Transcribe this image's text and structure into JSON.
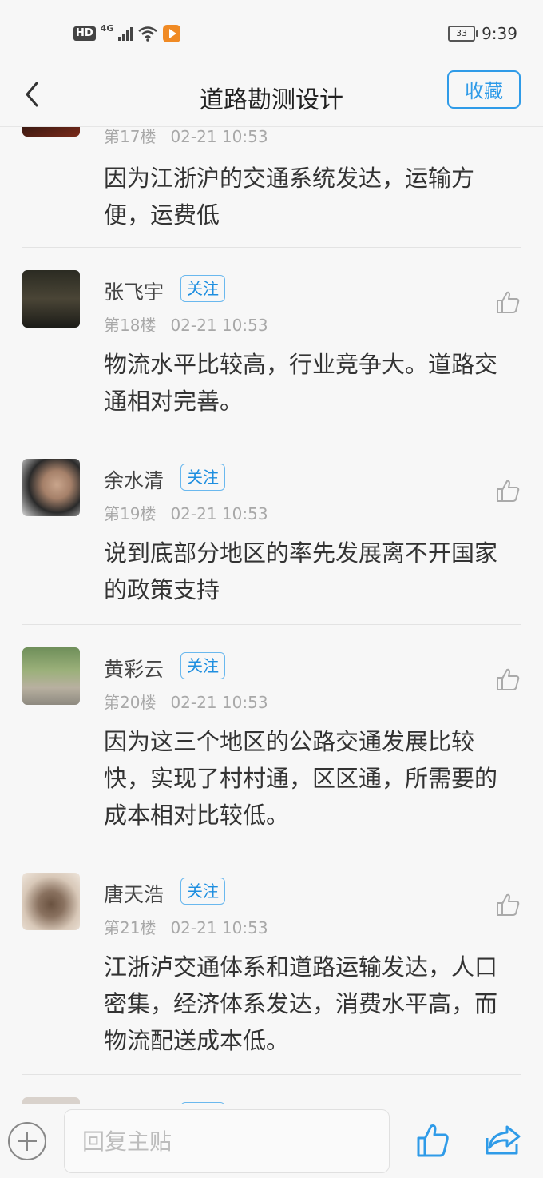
{
  "status_bar": {
    "hd": "HD",
    "network": "4G",
    "battery": "33",
    "time": "9:39"
  },
  "nav": {
    "title": "道路勘测设计",
    "favorite_label": "收藏"
  },
  "follow_label": "关注",
  "posts": [
    {
      "user": "",
      "floor": "第17楼",
      "time": "02-21 10:53",
      "content": "因为江浙沪的交通系统发达，运输方便，运费低"
    },
    {
      "user": "张飞宇",
      "floor": "第18楼",
      "time": "02-21 10:53",
      "content": "物流水平比较高，行业竞争大。道路交通相对完善。"
    },
    {
      "user": "余水清",
      "floor": "第19楼",
      "time": "02-21 10:53",
      "content": "说到底部分地区的率先发展离不开国家的政策支持"
    },
    {
      "user": "黄彩云",
      "floor": "第20楼",
      "time": "02-21 10:53",
      "content": "因为这三个地区的公路交通发展比较快，实现了村村通，区区通，所需要的成本相对比较低。"
    },
    {
      "user": "唐天浩",
      "floor": "第21楼",
      "time": "02-21 10:53",
      "content": "江浙泸交通体系和道路运输发达，人口密集，经济体系发达，消费水平高，而物流配送成本低。"
    }
  ],
  "bottom_bar": {
    "reply_placeholder": "回复主贴"
  },
  "colors": {
    "accent": "#2f9be8",
    "meta_text": "#a8a8a8",
    "background": "#f7f7f7"
  },
  "icons": [
    "back-arrow-icon",
    "thumbs-up-icon",
    "plus-circle-icon",
    "share-icon",
    "signal-icon",
    "wifi-icon",
    "battery-icon"
  ]
}
